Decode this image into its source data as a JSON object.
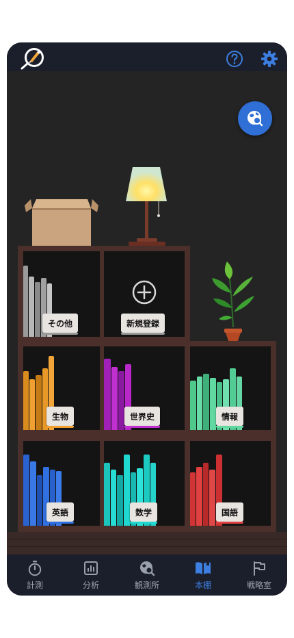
{
  "header": {
    "help_icon": "help-circle-icon",
    "settings_icon": "gear-icon"
  },
  "shelves": [
    {
      "label": "その他",
      "accent": "#9a9a9a"
    },
    {
      "label": "新規登録",
      "accent": "#9a9a9a"
    },
    {
      "label": "生物",
      "accent": "#f0a030"
    },
    {
      "label": "世界史",
      "accent": "#c030d0"
    },
    {
      "label": "情報",
      "accent": "#60d8a0"
    },
    {
      "label": "英語",
      "accent": "#3070e0"
    },
    {
      "label": "数学",
      "accent": "#20d8d0"
    },
    {
      "label": "国語",
      "accent": "#e04040"
    }
  ],
  "tabs": [
    {
      "label": "計測",
      "icon": "stopwatch-icon"
    },
    {
      "label": "分析",
      "icon": "chart-icon"
    },
    {
      "label": "観測所",
      "icon": "globe-search-icon"
    },
    {
      "label": "本棚",
      "icon": "book-icon",
      "active": true
    },
    {
      "label": "戦略室",
      "icon": "flag-icon"
    }
  ],
  "colors": {
    "accent": "#3c7fe0",
    "background": "#242424",
    "bar": "#1b1f2c",
    "shelf": "#4a2f2b"
  }
}
